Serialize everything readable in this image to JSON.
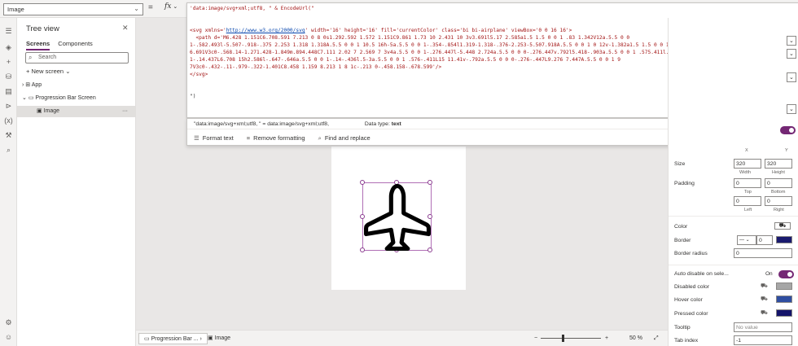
{
  "property_selector": {
    "value": "Image"
  },
  "formula_bar": {
    "eq": "=",
    "fx": "fx"
  },
  "formula": {
    "line1_prefix": "'data:image/svg+xml;utf8, \" & EncodeUrl(\"",
    "svg_open_a": "<svg xmlns='",
    "svg_url": "http://www.w3.org/2000/svg",
    "svg_open_b": "' width='16' height='16' fill='currentColor' class='bi bi-airplane' viewBox='0 0 16 16'>",
    "path_line1": "  <path d='M6.428 1.151C6.708.591 7.213 0 8 0s1.292.592 1.572 1.151C9.861 1.73 10 2.431 10 3v3.691l5.17 2.585a1.5 1.5 0 0 1 .83 1.342V12a.5.5 0 0",
    "path_line2": "1-.582.493l-5.507-.918-.375 2.253 1.318 1.318A.5.5 0 0 1 10.5 16h-5a.5.5 0 0 1-.354-.854l1.319-1.318-.376-2.253-5.507.918A.5.5 0 0 1 0 12v-1.382a1.5 1.5 0 0 1 .83-1.342L6",
    "path_line3": "6.691V3c0-.568.14-1.271.428-1.849m.894.448C7.111 2.02 7 2.569 7 3v4a.5.5 0 0 1-.276.447l-5.448 2.724a.5.5 0 0 0-.276.447v.792l5.418-.903a.5.5 0 0 1 .575.411l.5 3a.5.5 0 0",
    "path_line4": "1-.14.437L6.708 15h2.586l-.647-.646a.5.5 0 0 1-.14-.436l.5-3a.5.5 0 0 1 .576-.411L15 11.41v-.792a.5.5 0 0 0-.276-.447L9.276 7.447A.5.5 0 0 1 9",
    "path_line5": "7V3c0-.432-.11-.979-.322-1.401C8.458 1.159 8.213 1 8 1c-.213 0-.458.158-.678.599'/>",
    "svg_close": "</svg>",
    "closing": "\")"
  },
  "formula_panel": {
    "result_expr": "\"data:image/svg+xml;utf8, \"  =  data:image/svg+xml;utf8,",
    "data_type_label": "Data type:",
    "data_type_value": "text",
    "format_text": "Format text",
    "remove_formatting": "Remove formatting",
    "find_replace": "Find and replace"
  },
  "tree": {
    "title": "Tree view",
    "tabs": [
      "Screens",
      "Components"
    ],
    "search_placeholder": "Search",
    "new_screen": "New screen",
    "nodes": [
      "App",
      "Progression Bar Screen",
      "Image"
    ]
  },
  "right_panel": {
    "position_x_label": "X",
    "position_y_label": "Y",
    "size_label": "Size",
    "width": "320",
    "height": "320",
    "width_label": "Width",
    "height_label": "Height",
    "padding_label": "Padding",
    "pad_top": "0",
    "pad_bottom": "0",
    "pad_left": "0",
    "pad_right": "0",
    "top_label": "Top",
    "bottom_label": "Bottom",
    "left_label": "Left",
    "right_label": "Right",
    "color_label": "Color",
    "border_label": "Border",
    "border_value": "0",
    "border_radius_label": "Border radius",
    "border_radius_value": "0",
    "auto_disable_label": "Auto disable on sele...",
    "auto_disable_value": "On",
    "disabled_color_label": "Disabled color",
    "hover_color_label": "Hover color",
    "pressed_color_label": "Pressed color",
    "tooltip_label": "Tooltip",
    "tooltip_placeholder": "No value",
    "tab_index_label": "Tab index",
    "tab_index_value": "-1",
    "colors": {
      "border": "#1a1a6e",
      "disabled": "#a6a6a6",
      "hover": "#2f4ea1",
      "pressed": "#14146a"
    }
  },
  "bottom": {
    "tab1": "Progression Bar ...",
    "tab2": "Image",
    "zoom_minus": "−",
    "zoom_plus": "+",
    "zoom_value": "50",
    "zoom_unit": "%"
  },
  "accent": "#742774"
}
